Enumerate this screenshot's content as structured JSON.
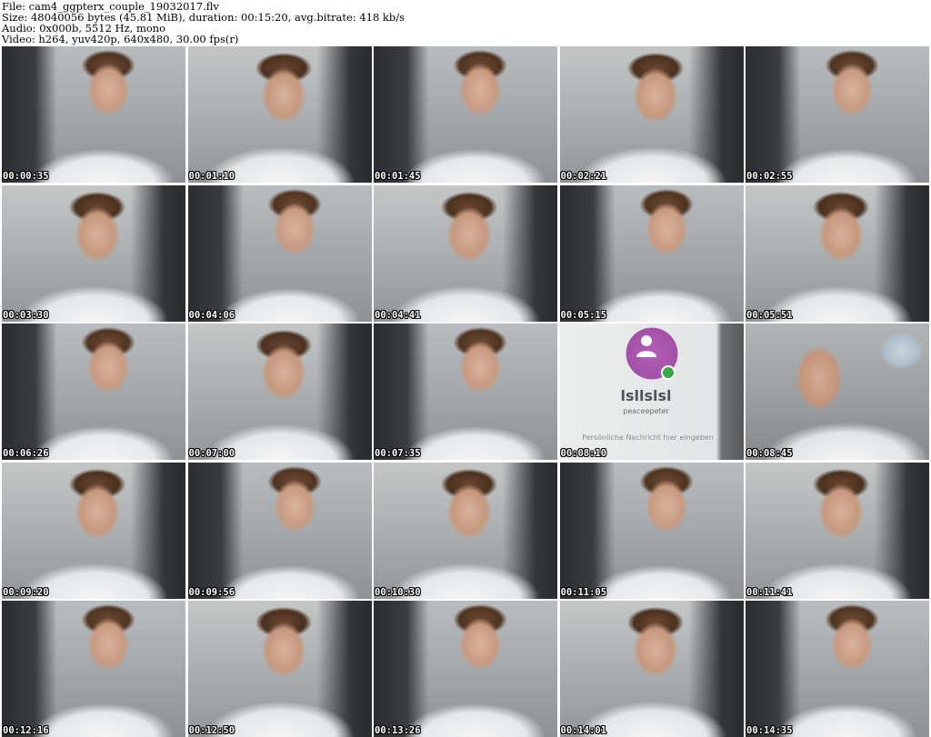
{
  "header": {
    "file_line": "File: cam4_ggpterx_couple_19032017.flv",
    "size_line": "Size: 48040056 bytes (45.81 MiB), duration: 00:15:20, avg.bitrate: 418 kb/s",
    "audio_line": "Audio: 0x000b, 5512 Hz, mono",
    "video_line": "Video: h264, yuv420p, 640x480, 30.00 fps(r)"
  },
  "thumbnails": [
    {
      "timestamp": "00:00:35",
      "scene": "person-webcam"
    },
    {
      "timestamp": "00:01:10",
      "scene": "person-webcam"
    },
    {
      "timestamp": "00:01:45",
      "scene": "person-webcam"
    },
    {
      "timestamp": "00:02:21",
      "scene": "person-webcam"
    },
    {
      "timestamp": "00:02:55",
      "scene": "person-webcam"
    },
    {
      "timestamp": "00:03:30",
      "scene": "person-webcam"
    },
    {
      "timestamp": "00:04:06",
      "scene": "person-webcam"
    },
    {
      "timestamp": "00:04:41",
      "scene": "person-webcam"
    },
    {
      "timestamp": "00:05:15",
      "scene": "person-webcam"
    },
    {
      "timestamp": "00:05:51",
      "scene": "person-webcam"
    },
    {
      "timestamp": "00:06:26",
      "scene": "person-webcam"
    },
    {
      "timestamp": "00:07:00",
      "scene": "person-webcam"
    },
    {
      "timestamp": "00:07:35",
      "scene": "person-webcam"
    },
    {
      "timestamp": "00:08:10",
      "scene": "phone-screen"
    },
    {
      "timestamp": "00:08:45",
      "scene": "person-with-phone"
    },
    {
      "timestamp": "00:09:20",
      "scene": "person-webcam"
    },
    {
      "timestamp": "00:09:56",
      "scene": "person-webcam"
    },
    {
      "timestamp": "00:10:30",
      "scene": "person-webcam"
    },
    {
      "timestamp": "00:11:05",
      "scene": "person-webcam"
    },
    {
      "timestamp": "00:11:41",
      "scene": "person-webcam"
    },
    {
      "timestamp": "00:12:16",
      "scene": "person-webcam"
    },
    {
      "timestamp": "00:12:50",
      "scene": "person-webcam"
    },
    {
      "timestamp": "00:13:26",
      "scene": "person-webcam"
    },
    {
      "timestamp": "00:14:01",
      "scene": "person-webcam"
    },
    {
      "timestamp": "00:14:35",
      "scene": "person-webcam"
    }
  ],
  "phone_screen": {
    "contact_name": "lsllslsl",
    "contact_handle": "peaceepeter",
    "message_placeholder": "Persönliche Nachricht hier eingeben",
    "accent_color": "#a350a8",
    "status_color": "#3aa84a",
    "avatar_icon": "person-icon"
  }
}
